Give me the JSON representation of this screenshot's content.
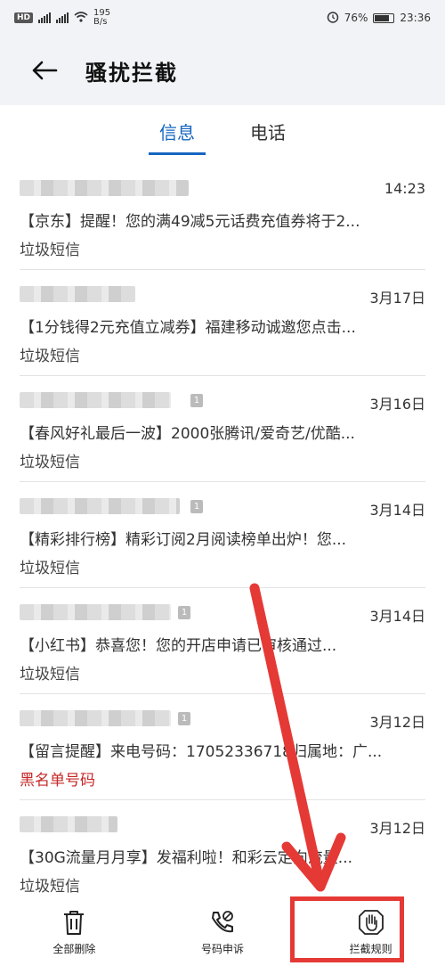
{
  "status": {
    "hd": "HD",
    "net_speed": "195\nB/s",
    "net_speed_value": "195",
    "net_speed_unit": "B/s",
    "battery": "76%",
    "time": "23:36"
  },
  "header": {
    "title": "骚扰拦截"
  },
  "tabs": [
    {
      "label": "信息",
      "active": true
    },
    {
      "label": "电话",
      "active": false
    }
  ],
  "messages": [
    {
      "time": "14:23",
      "preview": "【京东】提醒！您的满49减5元话费充值券将于2...",
      "tag": "垃圾短信",
      "tag_type": "spam",
      "sim": false
    },
    {
      "time": "3月17日",
      "preview": "【1分钱得2元充值立减券】福建移动诚邀您点击...",
      "tag": "垃圾短信",
      "tag_type": "spam",
      "sim": false
    },
    {
      "time": "3月16日",
      "preview": "【春风好礼最后一波】2000张腾讯/爱奇艺/优酷...",
      "tag": "垃圾短信",
      "tag_type": "spam",
      "sim": true
    },
    {
      "time": "3月14日",
      "preview": "【精彩排行榜】精彩订阅2月阅读榜单出炉！您...",
      "tag": "垃圾短信",
      "tag_type": "spam",
      "sim": true
    },
    {
      "time": "3月14日",
      "preview": "【小红书】恭喜您！您的开店申请已审核通过...",
      "tag": "垃圾短信",
      "tag_type": "spam",
      "sim": true
    },
    {
      "time": "3月12日",
      "preview": "【留言提醒】来电号码：17052336718归属地：广...",
      "tag": "黑名单号码",
      "tag_type": "blacklist",
      "sim": true
    },
    {
      "time": "3月12日",
      "preview": "【30G流量月月享】发福利啦！和彩云定向流量...",
      "tag": "垃圾短信",
      "tag_type": "spam",
      "sim": false
    }
  ],
  "bottom": {
    "delete_all": "全部删除",
    "appeal": "号码申诉",
    "rules": "拦截规则"
  },
  "colors": {
    "accent": "#1565c0",
    "blacklist": "#c62828",
    "annotation": "#e53935"
  }
}
